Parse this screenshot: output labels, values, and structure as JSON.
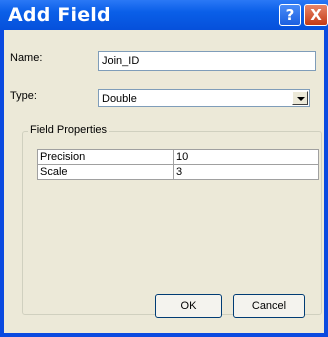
{
  "dialog": {
    "title": "Add Field",
    "help_label": "?",
    "close_label": "X"
  },
  "form": {
    "name_label": "Name:",
    "name_value": "Join_ID",
    "type_label": "Type:",
    "type_value": "Double"
  },
  "field_properties": {
    "title": "Field Properties",
    "rows": [
      {
        "property": "Precision",
        "value": "10"
      },
      {
        "property": "Scale",
        "value": "3"
      }
    ]
  },
  "buttons": {
    "ok": "OK",
    "cancel": "Cancel"
  }
}
